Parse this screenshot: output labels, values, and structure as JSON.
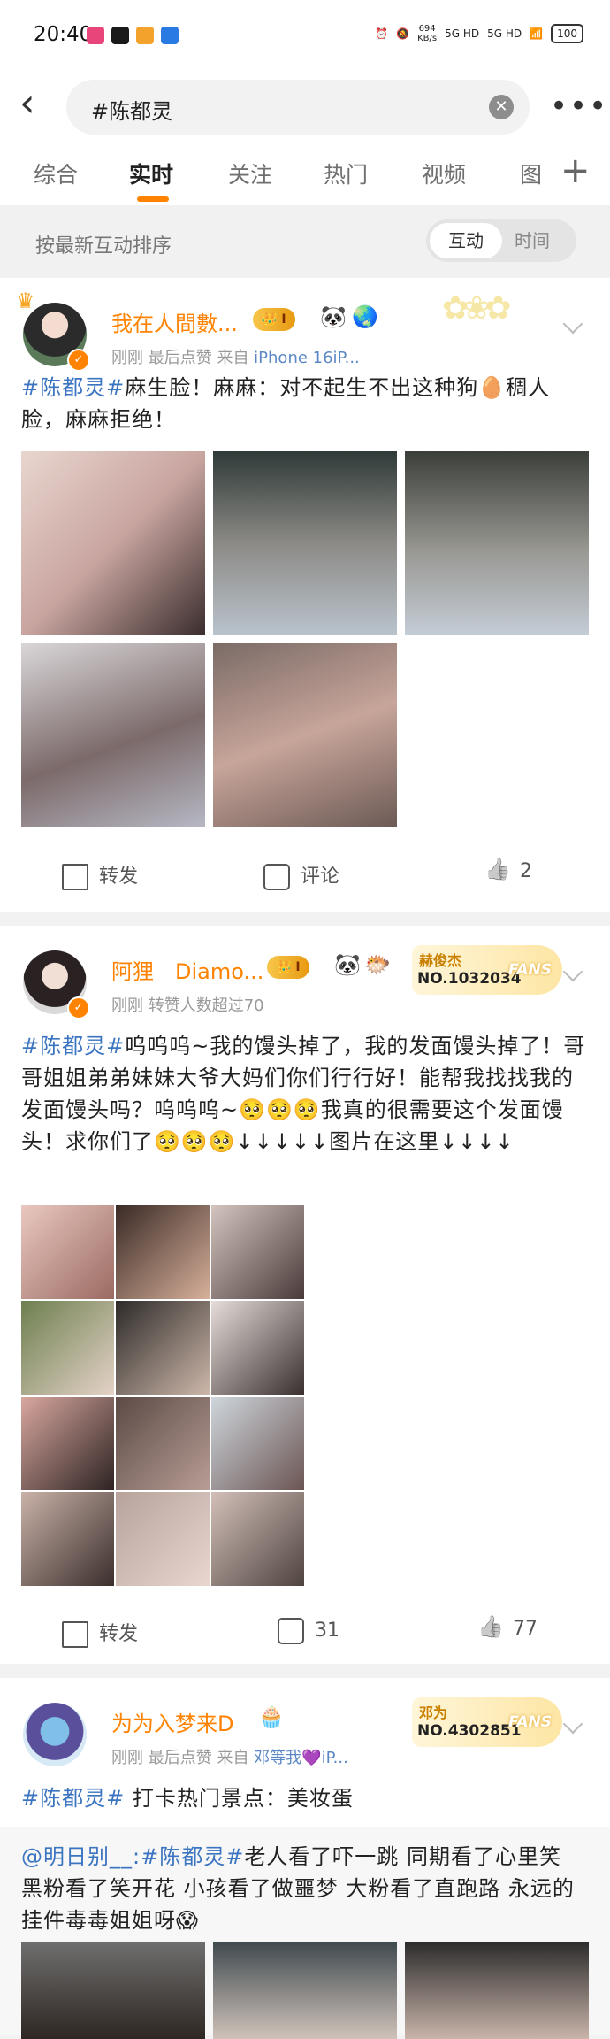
{
  "status_bar": {
    "time": "20:40",
    "net_speed": "694",
    "net_unit": "KB/s",
    "sim1": "5G HD",
    "sim2": "5G HD",
    "battery": "100"
  },
  "search": {
    "query": "#陈都灵"
  },
  "tabs": [
    {
      "label": "综合"
    },
    {
      "label": "实时",
      "active": true
    },
    {
      "label": "关注"
    },
    {
      "label": "热门"
    },
    {
      "label": "视频"
    },
    {
      "label": "图"
    }
  ],
  "sort": {
    "label": "按最新互动排序",
    "option_on": "互动",
    "option_off": "时间"
  },
  "posts": [
    {
      "username": "我在人間數...",
      "badge": "I",
      "meta_prefix": "刚刚 最后点赞  来自 ",
      "meta_source": "iPhone 16iP...",
      "hashtag": "#陈都灵#",
      "text": "麻生脸！麻麻：对不起生不出这种狗🥚稠人脸，麻麻拒绝！",
      "repost_label": "转发",
      "comment_label": "评论",
      "like_count": "2"
    },
    {
      "username": "阿狸＿Diamo...",
      "badge": "I",
      "meta": "刚刚 转赞人数超过70",
      "fans_name": "赫俊杰",
      "fans_no": "NO.1032034",
      "fans_tag": "FANS",
      "hashtag": "#陈都灵#",
      "text": "呜呜呜~我的馒头掉了，我的发面馒头掉了！哥哥姐姐弟弟妹妹大爷大妈们你们行行好！能帮我找找我的发面馒头吗？呜呜呜~🥺🥺🥺我真的很需要这个发面馒头！求你们了🥺🥺🥺↓↓↓↓↓图片在这里↓↓↓↓",
      "repost_label": "转发",
      "comment_count": "31",
      "like_count": "77"
    },
    {
      "username": "为为入梦来D",
      "meta_prefix": "刚刚 最后点赞  来自 ",
      "meta_source": "邓等我💜iP...",
      "fans_name": "邓为",
      "fans_no": "NO.4302851",
      "fans_tag": "FANS",
      "hashtag": "#陈都灵#",
      "text": " 打卡热门景点：美妆蛋",
      "quote_at": "@明日别__:",
      "quote_hashtag": "#陈都灵#",
      "quote_text": "老人看了吓一跳 同期看了心里笑 黑粉看了笑开花 小孩看了做噩梦 大粉看了直跑路 永远的挂件毒毒姐姐呀😱"
    }
  ],
  "colors": {
    "accent": "#ff8200",
    "link": "#3b74c0"
  }
}
